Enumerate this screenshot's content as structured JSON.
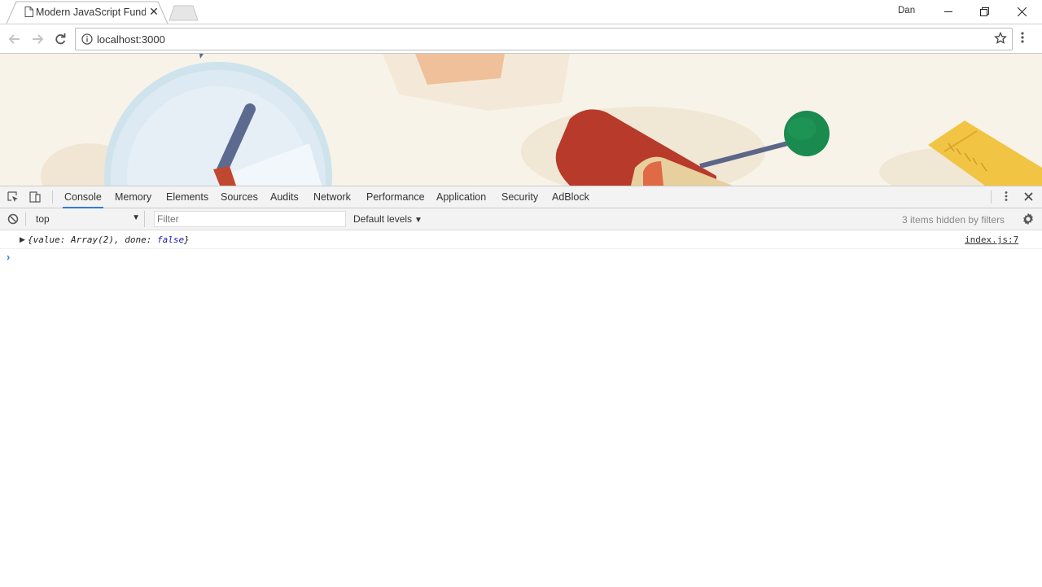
{
  "browser": {
    "tab_title": "Modern JavaScript Funda",
    "profile_name": "Dan",
    "url": "localhost:3000"
  },
  "devtools": {
    "tabs": [
      "Console",
      "Memory",
      "Elements",
      "Sources",
      "Audits",
      "Network",
      "Performance",
      "Application",
      "Security",
      "AdBlock"
    ],
    "active_tab": "Console",
    "context": "top",
    "filter_placeholder": "Filter",
    "levels": "Default levels",
    "hidden_info": "3 items hidden by filters"
  },
  "console": {
    "log": {
      "prefix": "{value: Array(2), done: ",
      "bool": "false",
      "suffix": "}",
      "source": "index.js:7"
    },
    "prompt": "›"
  },
  "colors": {
    "accent": "#3879d9",
    "page_bg": "#f8f3e8"
  },
  "icons": [
    "page-icon",
    "close-icon",
    "minimize-icon",
    "restore-icon",
    "back-icon",
    "forward-icon",
    "reload-icon",
    "info-icon",
    "star-icon",
    "more-vert-icon",
    "inspect-icon",
    "device-icon",
    "clear-console-icon",
    "gear-icon"
  ]
}
